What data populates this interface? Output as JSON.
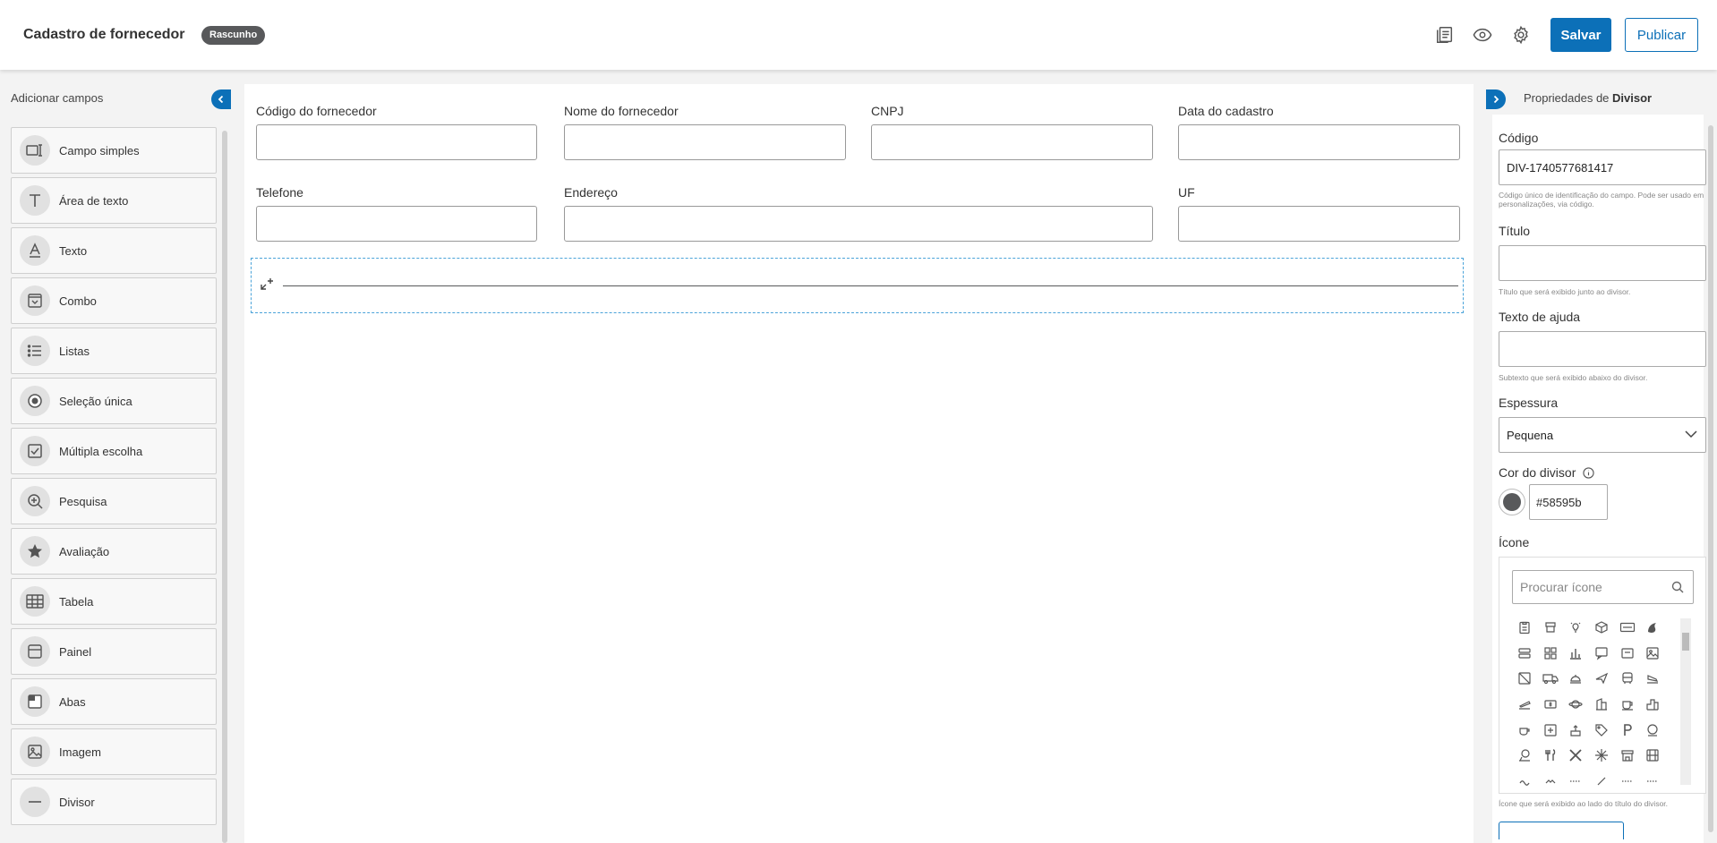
{
  "header": {
    "title": "Cadastro de fornecedor",
    "status_badge": "Rascunho",
    "save_label": "Salvar",
    "publish_label": "Publicar",
    "icons": [
      "list-view-icon",
      "eye-icon",
      "gear-icon"
    ]
  },
  "left_panel": {
    "title": "Adicionar campos",
    "items": [
      {
        "label": "Campo simples",
        "icon": "input-field-icon"
      },
      {
        "label": "Área de texto",
        "icon": "text-area-icon"
      },
      {
        "label": "Texto",
        "icon": "text-icon"
      },
      {
        "label": "Combo",
        "icon": "combo-icon"
      },
      {
        "label": "Listas",
        "icon": "list-icon"
      },
      {
        "label": "Seleção única",
        "icon": "radio-icon"
      },
      {
        "label": "Múltipla escolha",
        "icon": "checkbox-icon"
      },
      {
        "label": "Pesquisa",
        "icon": "zoom-search-icon"
      },
      {
        "label": "Avaliação",
        "icon": "star-icon"
      },
      {
        "label": "Tabela",
        "icon": "table-icon"
      },
      {
        "label": "Painel",
        "icon": "panel-icon"
      },
      {
        "label": "Abas",
        "icon": "tabs-icon"
      },
      {
        "label": "Imagem",
        "icon": "image-icon"
      },
      {
        "label": "Divisor",
        "icon": "divider-icon"
      }
    ]
  },
  "form": {
    "fields": [
      {
        "label": "Código do fornecedor",
        "value": ""
      },
      {
        "label": "Nome do fornecedor",
        "value": ""
      },
      {
        "label": "CNPJ",
        "value": ""
      },
      {
        "label": "Data do cadastro",
        "value": ""
      },
      {
        "label": "Telefone",
        "value": ""
      },
      {
        "label": "Endereço",
        "value": ""
      },
      {
        "label": "UF",
        "value": ""
      }
    ]
  },
  "properties": {
    "title_prefix": "Propriedades de ",
    "title_target": "Divisor",
    "code_label": "Código",
    "code_value": "DIV-1740577681417",
    "code_help": "Código único de identificação do campo. Pode ser usado em personalizações, via código.",
    "title_label": "Título",
    "title_value": "",
    "title_help": "Título que será exibido junto ao divisor.",
    "helptext_label": "Texto de ajuda",
    "helptext_value": "",
    "helptext_help": "Subtexto que será exibido abaixo do divisor.",
    "thickness_label": "Espessura",
    "thickness_value": "Pequena",
    "color_label": "Cor do divisor",
    "color_value": "#58595b",
    "icon_label": "Ícone",
    "icon_search_placeholder": "Procurar ícone",
    "icon_help": "Ícone que será exibido ao lado do título do divisor."
  },
  "colors": {
    "primary": "#0c70b8",
    "badge": "#58595b",
    "divider": "#58595b",
    "dashed_selection": "#4aa3d9"
  }
}
